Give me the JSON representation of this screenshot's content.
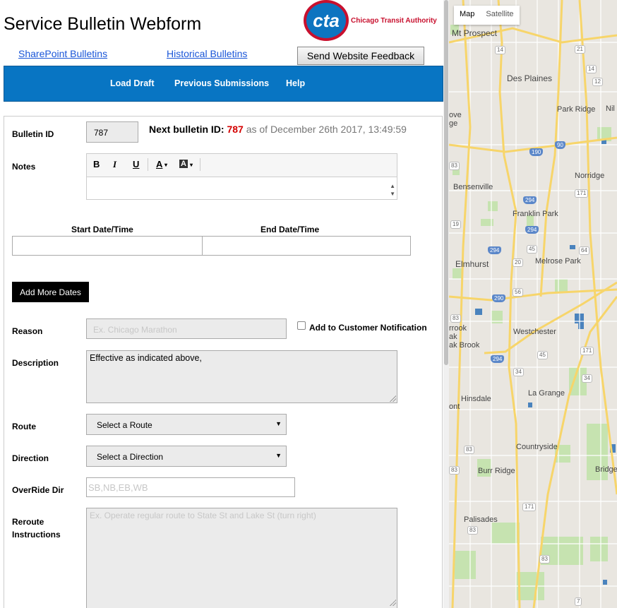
{
  "header": {
    "title": "Service Bulletin Webform",
    "logo_mark": "cta",
    "logo_text": "Chicago Transit Authority",
    "links": [
      "SharePoint Bulletins",
      "Historical Bulletins"
    ],
    "feedback_button": "Send Website Feedback"
  },
  "nav": {
    "items": [
      "Load Draft",
      "Previous Submissions",
      "Help"
    ]
  },
  "form": {
    "bulletin_id_label": "Bulletin ID",
    "bulletin_id_value": "787",
    "next_id_label": "Next bulletin ID:",
    "next_id_value": "787",
    "next_id_suffix": "as of December 26th 2017, 13:49:59",
    "notes_label": "Notes",
    "toolbar": {
      "bold": "B",
      "italic": "I",
      "underline": "U",
      "font_color": "A",
      "bg_color": "A"
    },
    "start_label": "Start Date/Time",
    "end_label": "End Date/Time",
    "add_dates_button": "Add More Dates",
    "reason_label": "Reason",
    "reason_placeholder": "Ex. Chicago Marathon",
    "customer_notification_label": "Add to Customer Notification",
    "description_label": "Description",
    "description_value": "Effective as indicated above,",
    "route_label": "Route",
    "route_value": "Select a Route",
    "direction_label": "Direction",
    "direction_value": "Select a Direction",
    "override_label": "OverRide Dir",
    "override_placeholder": "SB,NB,EB,WB",
    "reroute_label_1": "Reroute",
    "reroute_label_2": "Instructions",
    "reroute_placeholder": "Ex. Operate regular route to State St and Lake St (turn right)"
  },
  "map": {
    "type_buttons": [
      "Map",
      "Satellite"
    ],
    "cities": [
      "Mt Prospect",
      "Des Plaines",
      "Park Ridge",
      "Norridge",
      "Bensenville",
      "Franklin Park",
      "Elmhurst",
      "Melrose Park",
      "Westchester",
      "ak Brook",
      "La Grange",
      "Hinsdale",
      "Countryside",
      "Burr Ridge",
      "Bridge",
      "Palisades",
      "ove",
      "ge",
      "rrook",
      "ak",
      "ont",
      "Nil"
    ],
    "shields": [
      "14",
      "21",
      "14",
      "12",
      "190",
      "90",
      "294",
      "171",
      "294",
      "83",
      "19",
      "294",
      "45",
      "64",
      "20",
      "56",
      "290",
      "83",
      "45",
      "171",
      "34",
      "34",
      "294",
      "83",
      "83",
      "171",
      "83",
      "83",
      "7"
    ],
    "colors": {
      "land": "#e9e6e0",
      "park": "#c6e3b0",
      "water": "#4a83bd",
      "highway": "#f7d56a",
      "road": "#ffffff"
    }
  }
}
